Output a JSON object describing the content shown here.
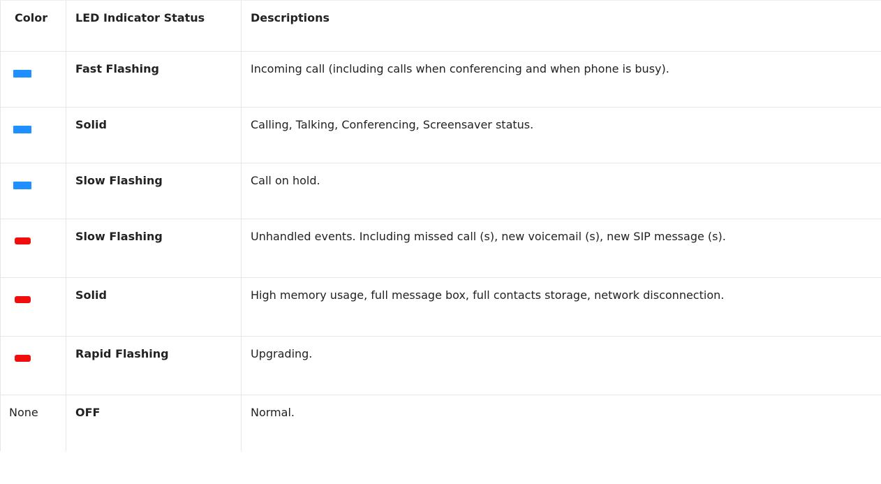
{
  "table": {
    "headers": {
      "color": "Color",
      "status": "LED Indicator Status",
      "description": "Descriptions"
    },
    "rows": [
      {
        "color": "#1e90ff",
        "color_kind": "blue",
        "status": "Fast Flashing",
        "description": "Incoming call (including calls when conferencing and when phone is busy)."
      },
      {
        "color": "#1e90ff",
        "color_kind": "blue",
        "status": "Solid",
        "description": "Calling, Talking, Conferencing, Screensaver status."
      },
      {
        "color": "#1e90ff",
        "color_kind": "blue",
        "status": "Slow Flashing",
        "description": "Call on hold."
      },
      {
        "color": "#f20d0d",
        "color_kind": "red",
        "status": "Slow Flashing",
        "description": "Unhandled events. Including missed call (s), new voicemail (s), new SIP message (s)."
      },
      {
        "color": "#f20d0d",
        "color_kind": "red",
        "status": "Solid",
        "description": "High memory usage, full message box, full contacts storage, network disconnection."
      },
      {
        "color": "#f20d0d",
        "color_kind": "red",
        "status": "Rapid Flashing",
        "description": "Upgrading."
      }
    ],
    "last_row": {
      "color_text": "None",
      "status": "OFF",
      "description": "Normal."
    }
  }
}
